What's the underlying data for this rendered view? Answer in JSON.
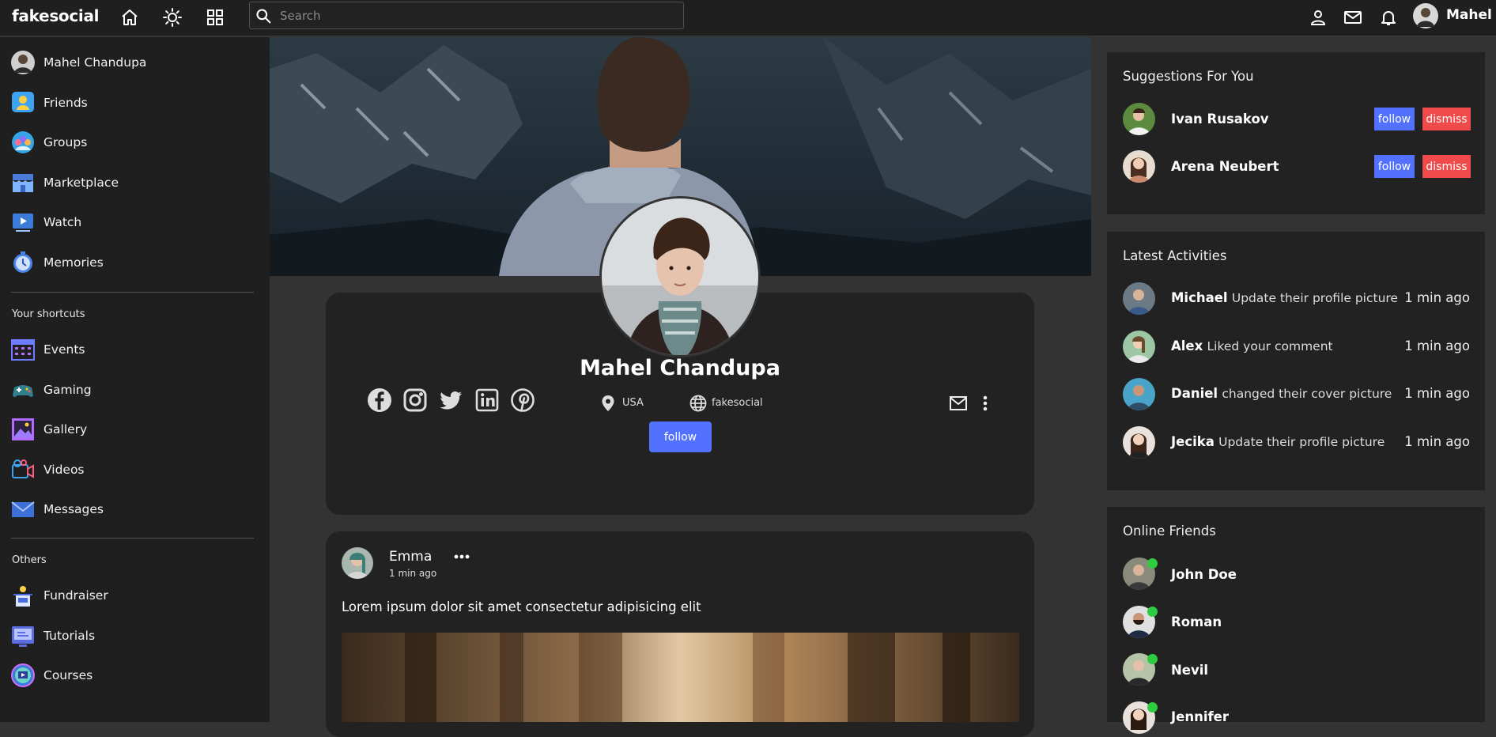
{
  "brand": "fakesocial",
  "navbar": {
    "search_placeholder": "Search",
    "user_name": "Mahel",
    "icons": [
      "home-icon",
      "theme-toggle-icon",
      "apps-grid-icon",
      "person-icon",
      "mail-icon",
      "bell-icon"
    ]
  },
  "sidebar": {
    "main_items": [
      {
        "label": "Mahel Chandupa",
        "icon": "avatar"
      },
      {
        "label": "Friends",
        "icon": "friends-icon"
      },
      {
        "label": "Groups",
        "icon": "groups-icon"
      },
      {
        "label": "Marketplace",
        "icon": "marketplace-icon"
      },
      {
        "label": "Watch",
        "icon": "watch-icon"
      },
      {
        "label": "Memories",
        "icon": "memories-icon"
      }
    ],
    "shortcuts_title": "Your shortcuts",
    "shortcuts": [
      {
        "label": "Events",
        "icon": "events-icon"
      },
      {
        "label": "Gaming",
        "icon": "gaming-icon"
      },
      {
        "label": "Gallery",
        "icon": "gallery-icon"
      },
      {
        "label": "Videos",
        "icon": "videos-icon"
      },
      {
        "label": "Messages",
        "icon": "messages-icon"
      }
    ],
    "others_title": "Others",
    "others": [
      {
        "label": "Fundraiser",
        "icon": "fundraiser-icon"
      },
      {
        "label": "Tutorials",
        "icon": "tutorials-icon"
      },
      {
        "label": "Courses",
        "icon": "courses-icon"
      }
    ]
  },
  "profile": {
    "name": "Mahel Chandupa",
    "location": "USA",
    "website": "fakesocial",
    "follow_label": "follow",
    "social_icons": [
      "facebook-icon",
      "instagram-icon",
      "twitter-icon",
      "linkedin-icon",
      "pinterest-icon"
    ]
  },
  "post": {
    "author": "Emma",
    "time": "1 min ago",
    "text": "Lorem ipsum dolor sit amet consectetur adipisicing elit"
  },
  "suggestions": {
    "title": "Suggestions For You",
    "follow_label": "follow",
    "dismiss_label": "dismiss",
    "people": [
      {
        "name": "Ivan Rusakov"
      },
      {
        "name": "Arena Neubert"
      }
    ]
  },
  "activities": {
    "title": "Latest Activities",
    "items": [
      {
        "name": "Michael",
        "action": "Update their profile picture",
        "time": "1 min ago"
      },
      {
        "name": "Alex",
        "action": "Liked your comment",
        "time": "1 min ago"
      },
      {
        "name": "Daniel",
        "action": "changed their cover picture",
        "time": "1 min ago"
      },
      {
        "name": "Jecika",
        "action": "Update their profile picture",
        "time": "1 min ago"
      }
    ]
  },
  "online": {
    "title": "Online Friends",
    "friends": [
      {
        "name": "John Doe"
      },
      {
        "name": "Roman"
      },
      {
        "name": "Nevil"
      },
      {
        "name": "Jennifer"
      }
    ]
  },
  "colors": {
    "accent": "#5271ff",
    "danger": "#f04a4a",
    "online": "#2ecc40",
    "card": "#222222",
    "background": "#333333"
  }
}
